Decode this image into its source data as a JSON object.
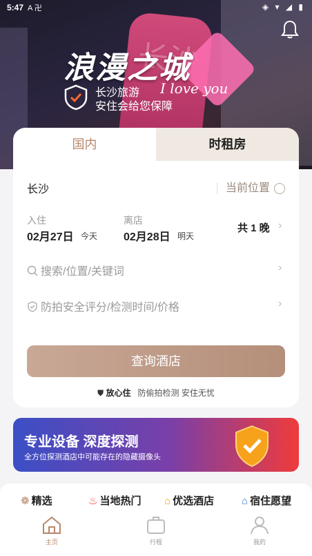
{
  "status": {
    "time": "5:47",
    "left_icons": "A 卍",
    "right_icons": "◈ ▾ ◢ ▮"
  },
  "hero": {
    "title": "浪漫之城",
    "subtitle_line1": "长沙旅游",
    "subtitle_line2": "安住会给您保障",
    "love_text": "I love you",
    "tower_text": "长沙"
  },
  "tabs": {
    "domestic": "国内",
    "hourly": "时租房"
  },
  "search": {
    "city": "长沙",
    "current_location": "当前位置",
    "checkin_label": "入住",
    "checkin_date": "02月27日",
    "checkin_day": "今天",
    "checkout_label": "离店",
    "checkout_date": "02月28日",
    "checkout_day": "明天",
    "nights": "共 1 晚",
    "keyword_placeholder": "搜索/位置/关键词",
    "filter_placeholder": "防拍安全评分/检测时间/价格",
    "search_button": "查询酒店",
    "safe_badge": "放心住",
    "safe_text": "防偷拍检测 安住无忧"
  },
  "banner": {
    "title": "专业设备 深度探测",
    "desc": "全方位探测酒店中可能存在的隐藏摄像头"
  },
  "categories": [
    "精选",
    "当地热门",
    "优选酒店",
    "宿住愿望"
  ],
  "nav": {
    "home": "主页",
    "trip": "行程",
    "mine": "我的"
  },
  "colors": {
    "accent": "#b7876c",
    "banner_start": "#3b4fc6",
    "banner_end": "#ef3b3b"
  }
}
